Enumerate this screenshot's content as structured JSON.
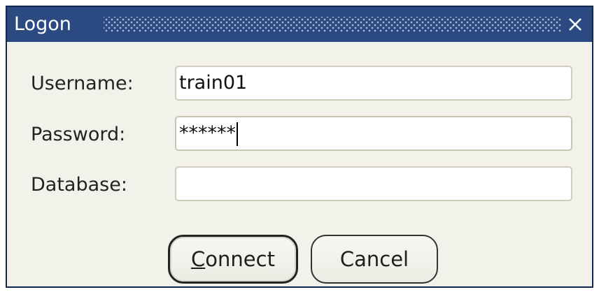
{
  "window": {
    "title": "Logon",
    "close_icon": "close-icon",
    "colors": {
      "titlebar": "#2b4a82",
      "background": "#f2f1ea",
      "border": "#14284e"
    }
  },
  "form": {
    "username_label": "Username:",
    "username_value": "train01",
    "password_label": "Password:",
    "password_value": "******",
    "database_label": "Database:",
    "database_value": ""
  },
  "buttons": {
    "connect_mnemonic": "C",
    "connect_rest": "onnect",
    "cancel_label": "Cancel"
  }
}
